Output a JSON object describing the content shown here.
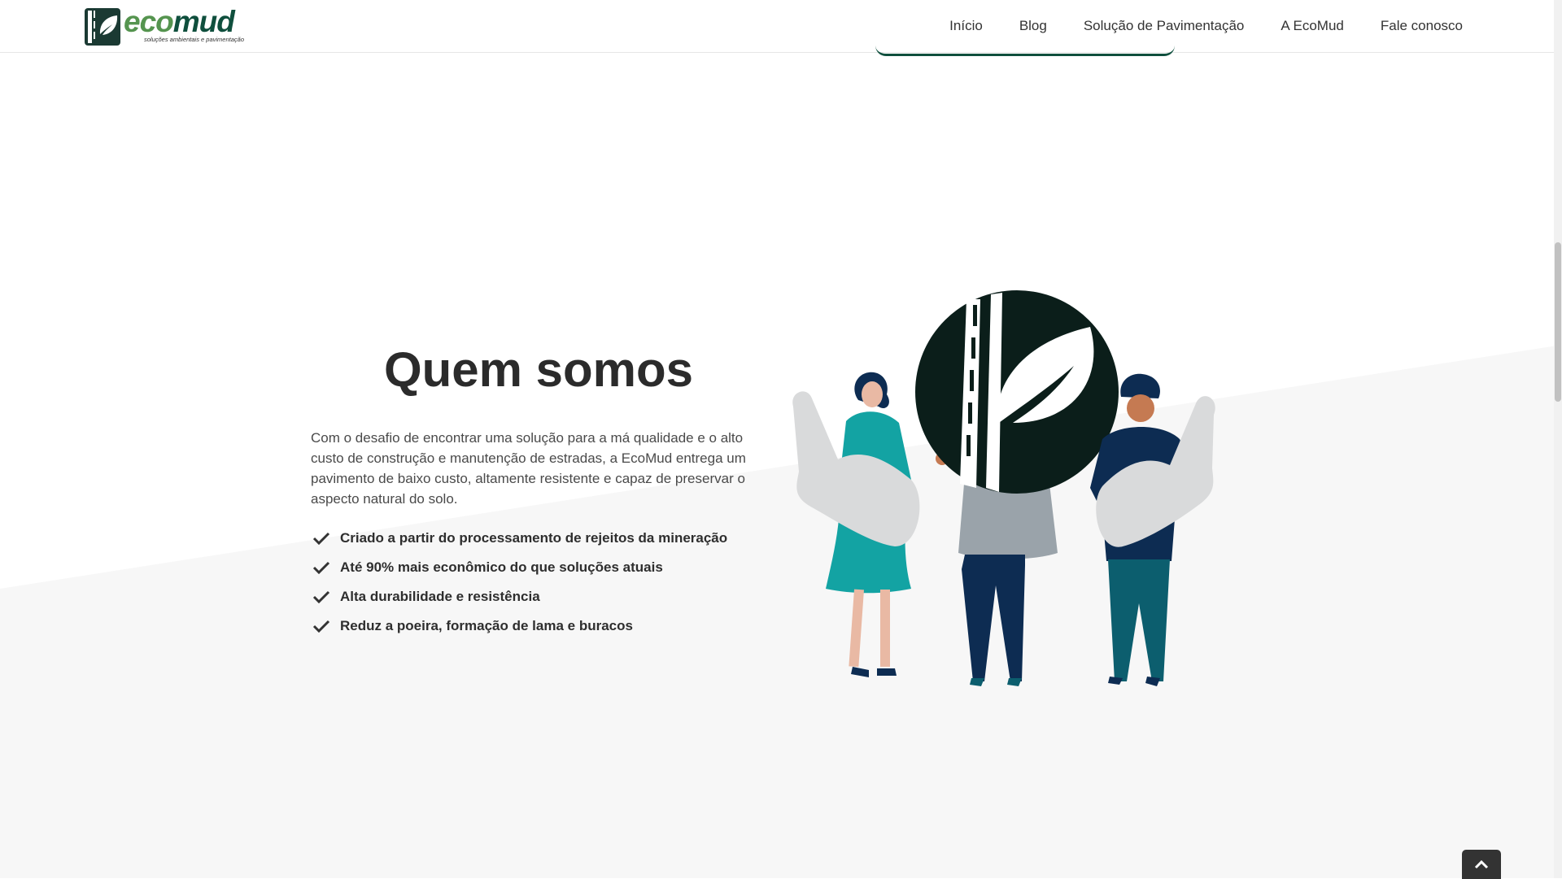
{
  "header": {
    "logo": {
      "word_eco": "eco",
      "word_mud": "mud",
      "tagline": "soluções ambientais e pavimentação"
    },
    "nav": [
      {
        "label": "Início"
      },
      {
        "label": "Blog"
      },
      {
        "label": "Solução de Pavimentação"
      },
      {
        "label": "A EcoMud"
      },
      {
        "label": "Fale conosco"
      }
    ]
  },
  "about": {
    "title": "Quem somos",
    "description": "Com o desafio de encontrar uma solução para a má qualidade e o alto custo de construção e manutenção de estradas, a EcoMud entrega um pavimento de baixo custo, altamente resistente e capaz de preservar o aspecto natural do solo.",
    "features": [
      "Criado a partir do processamento de rejeitos da mineração",
      "Até 90% mais econômico do que soluções atuais",
      "Alta durabilidade e resistência",
      "Reduz a poeira, formação de lama e buracos"
    ]
  },
  "icons": {
    "check": "check-icon",
    "to_top": "chevron-up-icon",
    "logo": "ecomud-logo-icon"
  },
  "colors": {
    "brand_green": "#55944f",
    "brand_dark": "#0f4f3d",
    "teal": "#13a3a3",
    "navy": "#0d2c52",
    "text": "#333333",
    "section_bg": "#f7f7f7"
  }
}
